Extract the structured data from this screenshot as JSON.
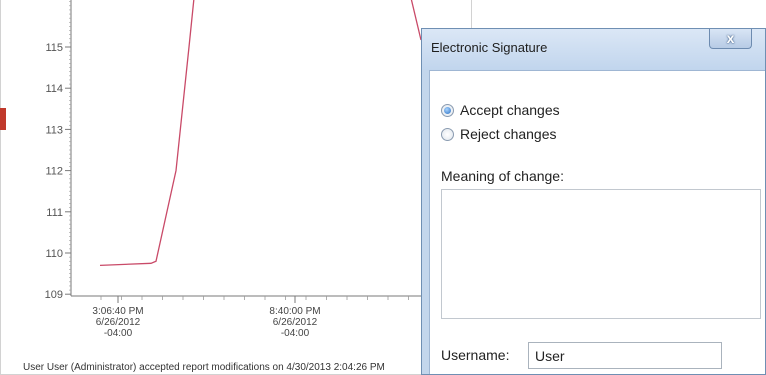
{
  "chart": {
    "status_text": "User User (Administrator) accepted report modifications on 4/30/2013 2:04:26 PM",
    "accent_color": "#c0392b"
  },
  "chart_data": {
    "type": "line",
    "y_ticks": [
      "115",
      "114",
      "113",
      "112",
      "111",
      "110",
      "109"
    ],
    "ylim": [
      108.95,
      116.4
    ],
    "x_ticks": [
      {
        "l1": "3:06:40 PM",
        "l2": "6/26/2012",
        "l3": "-04:00"
      },
      {
        "l1": "8:40:00 PM",
        "l2": "6/26/2012",
        "l3": "-04:00"
      }
    ],
    "series": [
      {
        "color": "#c94a68",
        "x": [
          0,
          1,
          2,
          3,
          4,
          5,
          6
        ],
        "values": [
          109.7,
          109.75,
          109.8,
          112.0,
          115.0,
          116.4,
          116.4
        ]
      }
    ]
  },
  "dialog": {
    "title": "Electronic Signature",
    "close_label": "x",
    "options": [
      {
        "label": "Accept changes",
        "checked": true
      },
      {
        "label": "Reject changes",
        "checked": false
      }
    ],
    "meaning_label": "Meaning of change:",
    "meaning_value": "",
    "username_label": "Username:",
    "username_value": "User"
  }
}
